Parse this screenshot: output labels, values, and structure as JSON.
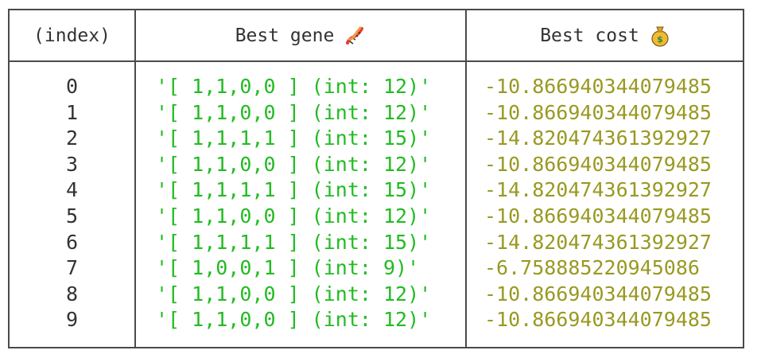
{
  "table": {
    "headers": {
      "index": "(index)",
      "gene": "Best gene",
      "cost": "Best cost"
    },
    "header_icons": {
      "gene": "dna-icon",
      "cost": "money-bag-icon"
    },
    "rows": [
      {
        "index": "0",
        "gene": "'[ 1,1,0,0 ] (int: 12)'",
        "cost": "-10.866940344079485"
      },
      {
        "index": "1",
        "gene": "'[ 1,1,0,0 ] (int: 12)'",
        "cost": "-10.866940344079485"
      },
      {
        "index": "2",
        "gene": "'[ 1,1,1,1 ] (int: 15)'",
        "cost": "-14.820474361392927"
      },
      {
        "index": "3",
        "gene": "'[ 1,1,0,0 ] (int: 12)'",
        "cost": "-10.866940344079485"
      },
      {
        "index": "4",
        "gene": "'[ 1,1,1,1 ] (int: 15)'",
        "cost": "-14.820474361392927"
      },
      {
        "index": "5",
        "gene": "'[ 1,1,0,0 ] (int: 12)'",
        "cost": "-10.866940344079485"
      },
      {
        "index": "6",
        "gene": "'[ 1,1,1,1 ] (int: 15)'",
        "cost": "-14.820474361392927"
      },
      {
        "index": "7",
        "gene": "'[ 1,0,0,1 ] (int: 9)'",
        "cost": "-6.758885220945086"
      },
      {
        "index": "8",
        "gene": "'[ 1,1,0,0 ] (int: 12)'",
        "cost": "-10.866940344079485"
      },
      {
        "index": "9",
        "gene": "'[ 1,1,0,0 ] (int: 12)'",
        "cost": "-10.866940344079485"
      }
    ],
    "colors": {
      "border": "#4a4a4a",
      "header_text": "#333333",
      "index_text": "#333333",
      "gene_text": "#22bb22",
      "cost_text": "#999922"
    }
  }
}
